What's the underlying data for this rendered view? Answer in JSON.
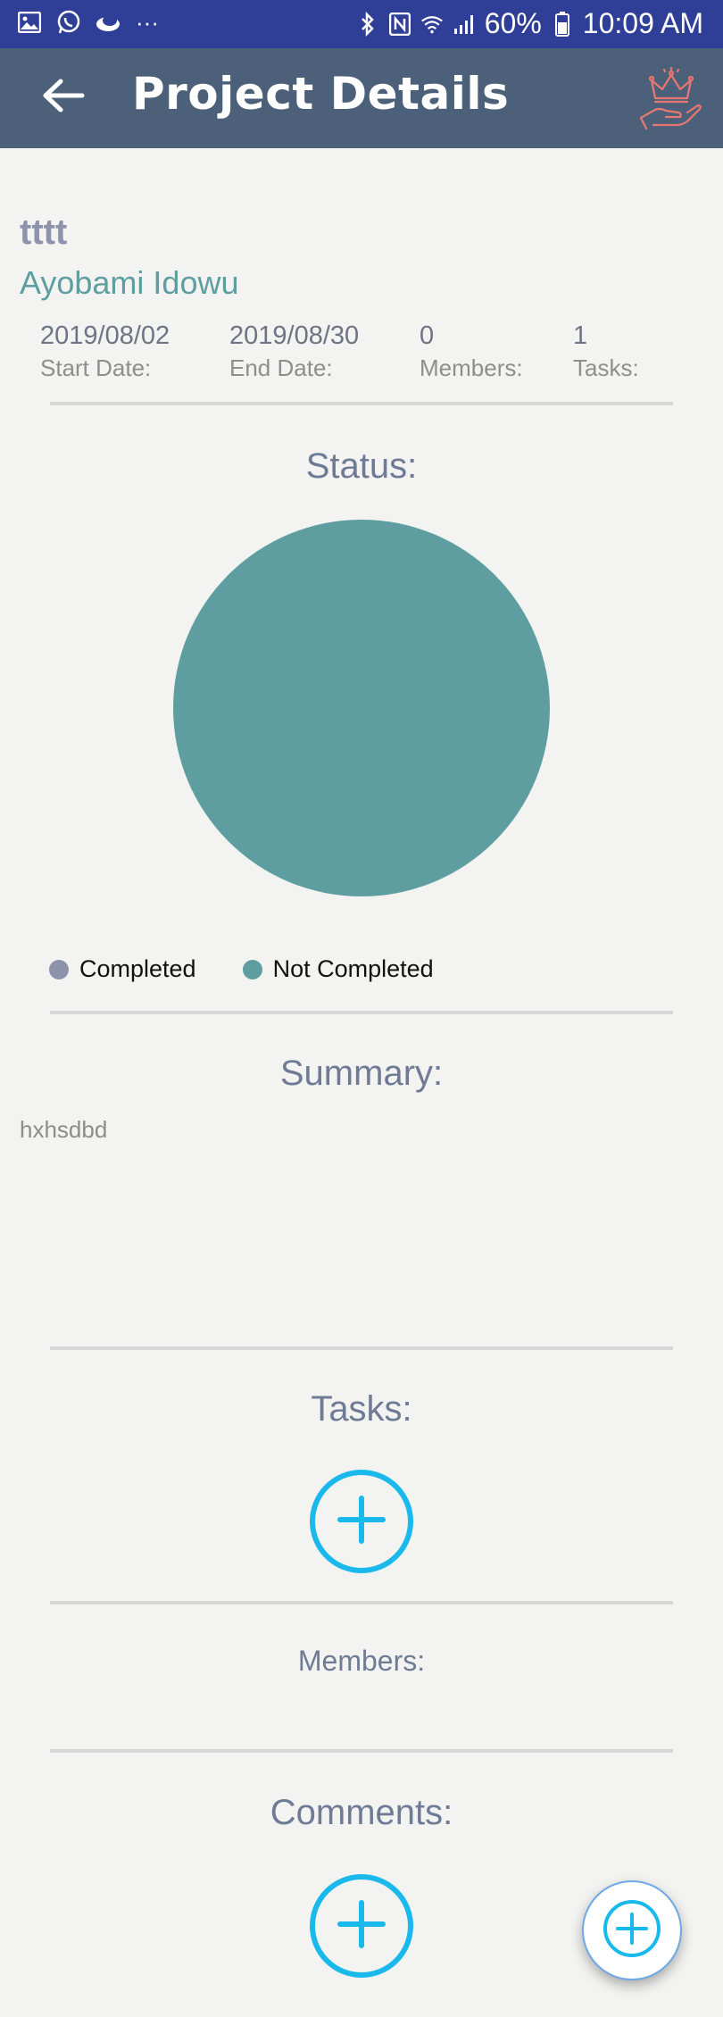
{
  "status_bar": {
    "battery": "60%",
    "time": "10:09 AM"
  },
  "app_bar": {
    "title": "Project Details"
  },
  "project": {
    "name": "tttt",
    "owner": "Ayobami Idowu"
  },
  "meta": [
    {
      "value": "2019/08/02",
      "label": "Start Date:"
    },
    {
      "value": "2019/08/30",
      "label": "End Date:"
    },
    {
      "value": "0",
      "label": "Members:"
    },
    {
      "value": "1",
      "label": "Tasks:"
    }
  ],
  "status_section": {
    "title": "Status:"
  },
  "chart_data": {
    "type": "pie",
    "categories": [
      "Completed",
      "Not Completed"
    ],
    "values": [
      0,
      1
    ],
    "colors": [
      "#8c93ab",
      "#5f9ea0"
    ],
    "legend_position": "bottom-left"
  },
  "legend": {
    "completed": "Completed",
    "not_completed": "Not Completed"
  },
  "summary": {
    "title": "Summary:",
    "text": "hxhsdbd"
  },
  "tasks": {
    "title": "Tasks:"
  },
  "members": {
    "title": "Members:"
  },
  "comments": {
    "title": "Comments:"
  },
  "colors": {
    "status_bar": "#2f3f98",
    "app_bar": "#4c607a",
    "accent_teal": "#5f9ea0",
    "add_blue": "#1ab9ec",
    "crown": "#e8786f"
  },
  "icons": {
    "back": "arrow-left-icon",
    "crown": "crown-hand-icon",
    "add": "plus-circle-icon"
  }
}
